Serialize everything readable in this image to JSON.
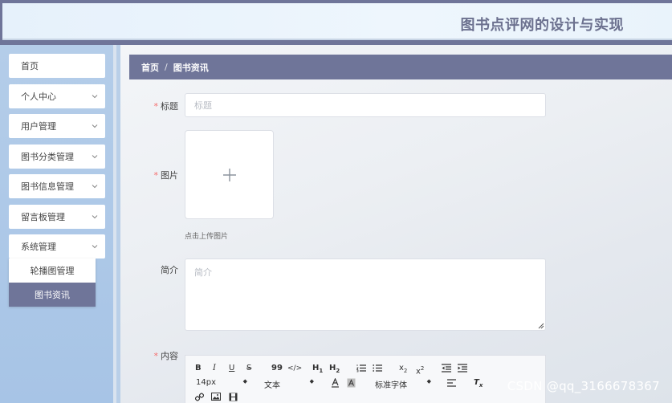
{
  "header": {
    "title": "图书点评网的设计与实现"
  },
  "sidebar": {
    "items": [
      {
        "label": "首页"
      },
      {
        "label": "个人中心"
      },
      {
        "label": "用户管理"
      },
      {
        "label": "图书分类管理"
      },
      {
        "label": "图书信息管理"
      },
      {
        "label": "留言板管理"
      },
      {
        "label": "系统管理"
      }
    ],
    "submenu": [
      {
        "label": "轮播图管理"
      },
      {
        "label": "图书资讯"
      }
    ]
  },
  "breadcrumb": {
    "home": "首页",
    "separator": "/",
    "current": "图书资讯"
  },
  "form": {
    "title": {
      "label": "标题",
      "placeholder": "标题",
      "value": ""
    },
    "image": {
      "label": "图片",
      "hint": "点击上传图片"
    },
    "summary": {
      "label": "简介",
      "placeholder": "简介",
      "value": ""
    },
    "content": {
      "label": "内容"
    }
  },
  "editor": {
    "bold": "B",
    "italic": "I",
    "underline": "U",
    "strike": "S",
    "blockquote": "99",
    "code": "</>",
    "h1": "H1",
    "h2": "H2",
    "sub": "x2",
    "sup": "x2",
    "font_size": "14px",
    "text_type": "文本",
    "font_family": "标准字体",
    "clean": "Tx"
  },
  "watermark": "CSDN @qq_3166678367",
  "colors": {
    "accent": "#6f7599",
    "required": "#f56c6c",
    "sidebar_bg": "#b4cde9"
  }
}
